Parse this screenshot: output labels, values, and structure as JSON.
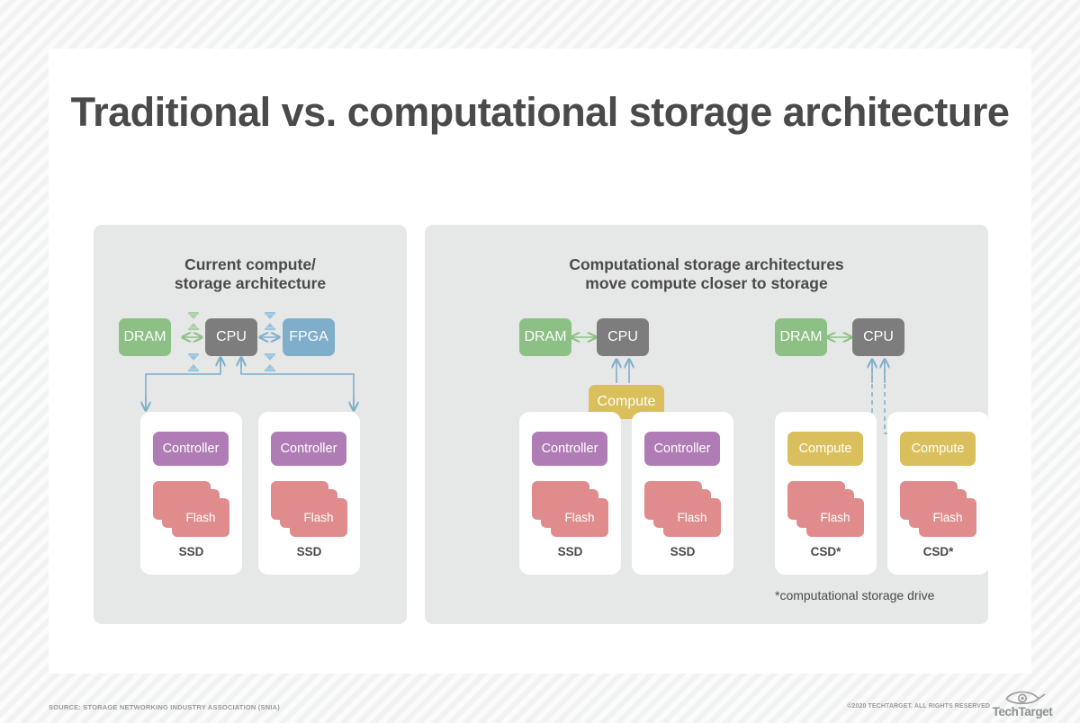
{
  "title": "Traditional vs. computational storage architecture",
  "panels": {
    "left": {
      "heading_line1": "Current compute/",
      "heading_line2": "storage architecture",
      "top_nodes": [
        {
          "label": "DRAM",
          "color": "#8cc084"
        },
        {
          "label": "CPU",
          "color": "#7d7d7d"
        },
        {
          "label": "FPGA",
          "color": "#7faecb"
        }
      ],
      "drives": [
        {
          "inner_label": "Controller",
          "inner_color": "#b07cb5",
          "flash_label": "Flash",
          "caption": "SSD"
        },
        {
          "inner_label": "Controller",
          "inner_color": "#b07cb5",
          "flash_label": "Flash",
          "caption": "SSD"
        }
      ]
    },
    "right": {
      "heading_line1": "Computational storage architectures",
      "heading_line2": "move compute closer to storage",
      "footnote": "*computational storage drive",
      "group_a": {
        "top_nodes": [
          {
            "label": "DRAM",
            "color": "#8cc084"
          },
          {
            "label": "CPU",
            "color": "#7d7d7d"
          }
        ],
        "compute_label": "Compute",
        "drives": [
          {
            "inner_label": "Controller",
            "inner_color": "#b07cb5",
            "flash_label": "Flash",
            "caption": "SSD"
          },
          {
            "inner_label": "Controller",
            "inner_color": "#b07cb5",
            "flash_label": "Flash",
            "caption": "SSD"
          }
        ]
      },
      "group_b": {
        "top_nodes": [
          {
            "label": "DRAM",
            "color": "#8cc084"
          },
          {
            "label": "CPU",
            "color": "#7d7d7d"
          }
        ],
        "drives": [
          {
            "inner_label": "Compute",
            "inner_color": "#d9c05c",
            "flash_label": "Flash",
            "caption": "CSD*"
          },
          {
            "inner_label": "Compute",
            "inner_color": "#d9c05c",
            "flash_label": "Flash",
            "caption": "CSD*"
          }
        ]
      }
    }
  },
  "footer": {
    "source": "SOURCE: STORAGE NETWORKING INDUSTRY ASSOCIATION (SNIA)",
    "copyright": "©2020 TECHTARGET. ALL RIGHTS RESERVED",
    "logo_word": "TechTarget",
    "logo_icon": "eye-icon"
  },
  "colors": {
    "background": "#f4f5f5",
    "card": "#ffffff",
    "panel": "#e6e7e7",
    "text_dark": "#4a4a4a",
    "green_link": "#8cc084",
    "blue_link": "#7faecb",
    "flash": "#e08c8c",
    "controller": "#b07cb5",
    "compute": "#d9c05c"
  }
}
